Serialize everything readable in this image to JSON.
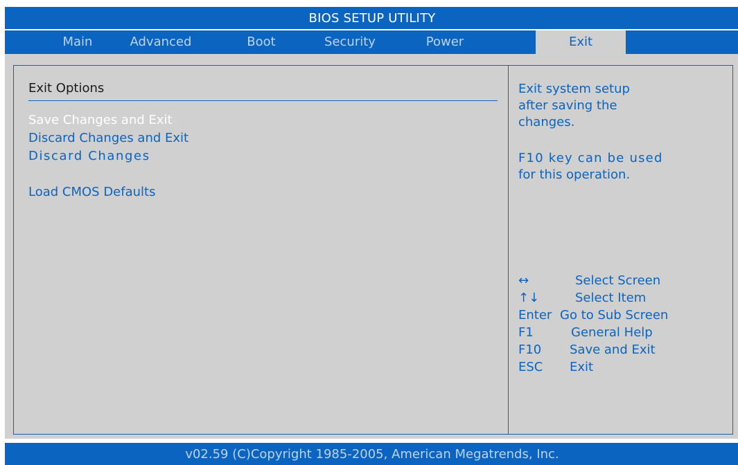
{
  "title": "BIOS SETUP UTILITY",
  "tabs": [
    {
      "label": "Main",
      "active": false
    },
    {
      "label": "Advanced",
      "active": false
    },
    {
      "label": "Boot",
      "active": false
    },
    {
      "label": "Security",
      "active": false
    },
    {
      "label": "Power",
      "active": false
    },
    {
      "label": "Exit",
      "active": true
    }
  ],
  "section": {
    "title": "Exit Options",
    "options": [
      {
        "label": "Save Changes and Exit",
        "selected": true
      },
      {
        "label": "Discard Changes and Exit",
        "selected": false
      },
      {
        "label": "Discard Changes",
        "selected": false
      },
      {
        "label": "Load CMOS Defaults",
        "selected": false
      }
    ]
  },
  "help": {
    "lines": [
      "Exit system setup",
      "after saving the",
      "changes.",
      "",
      "F10 key can be used",
      "for this operation."
    ]
  },
  "keys": [
    {
      "key": "↔",
      "desc": "Select Screen"
    },
    {
      "key": "↑↓",
      "desc": "Select Item"
    },
    {
      "key": "Enter",
      "desc": "Go to Sub Screen"
    },
    {
      "key": "F1",
      "desc": "General Help"
    },
    {
      "key": "F10",
      "desc": "Save and Exit"
    },
    {
      "key": "ESC",
      "desc": "Exit"
    }
  ],
  "footer": "v02.59 (C)Copyright 1985-2005, American Megatrends, Inc.",
  "colors": {
    "accent": "#0a64c0",
    "panel": "#d0d0d0",
    "selected_text": "#ffffff"
  }
}
